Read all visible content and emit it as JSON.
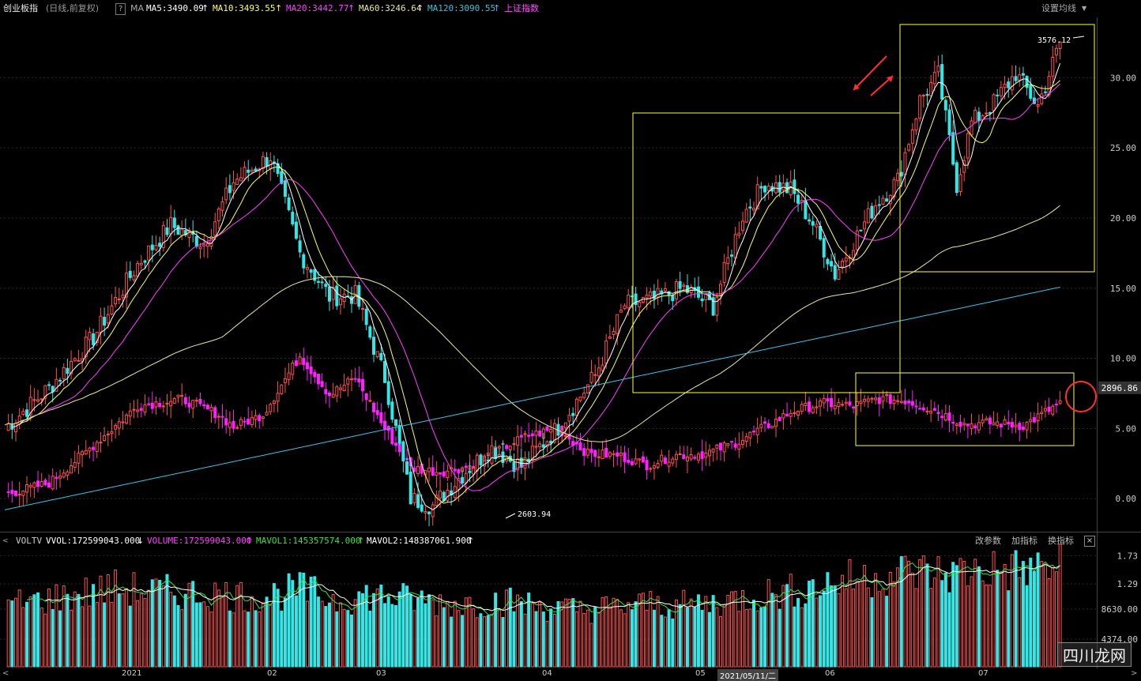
{
  "header": {
    "title": "创业板指",
    "mode": "(日线,前复权)",
    "help": "?",
    "ma_label": "MA",
    "ma5": "MA5:3490.09",
    "ma10": "MA10:3493.55",
    "ma20": "MA20:3442.77",
    "ma60": "MA60:3246.64",
    "ma120": "MA120:3090.55",
    "compare": "上证指数",
    "settings": "设置均线"
  },
  "colors": {
    "up": "#ff5050",
    "down": "#34e6e6",
    "ma5": "#ffffff",
    "ma10": "#ffff60",
    "ma20": "#ff40ff",
    "ma60": "#e8e8a0",
    "ma120": "#40c0e0",
    "box": "#ffff40"
  },
  "chart_data": [
    {
      "type": "candlestick",
      "title": "创业板指",
      "y_ticks_right": [
        "30.00",
        "25.00",
        "20.00",
        "15.00",
        "10.00",
        "5.00",
        "0.00"
      ],
      "ylim": [
        -2.3,
        34.3
      ],
      "highlight_value": "2896.86",
      "annotations": {
        "high": "3576.12",
        "low": "2603.94"
      },
      "x_ticks": [
        "2021",
        "02",
        "03",
        "04",
        "05",
        "2021/05/11/二",
        "06",
        "07"
      ],
      "ma_series": [
        "MA5",
        "MA10",
        "MA20",
        "MA60",
        "MA120"
      ],
      "points": [
        [
          0,
          5.0
        ],
        [
          12,
          7.9
        ],
        [
          24,
          11.5
        ],
        [
          36,
          16.7
        ],
        [
          45,
          19.5
        ],
        [
          54,
          18.2
        ],
        [
          62,
          22.6
        ],
        [
          72,
          24.4
        ],
        [
          80,
          17.5
        ],
        [
          88,
          14.4
        ],
        [
          95,
          14.5
        ],
        [
          103,
          8.6
        ],
        [
          110,
          0.0
        ],
        [
          116,
          -0.5
        ],
        [
          125,
          2.0
        ],
        [
          132,
          3.6
        ],
        [
          140,
          2.3
        ],
        [
          150,
          5.1
        ],
        [
          160,
          8.8
        ],
        [
          168,
          13.8
        ],
        [
          176,
          14.2
        ],
        [
          184,
          15.0
        ],
        [
          192,
          13.7
        ],
        [
          200,
          20.2
        ],
        [
          206,
          22.5
        ],
        [
          213,
          22.0
        ],
        [
          219,
          19.6
        ],
        [
          225,
          16.0
        ],
        [
          230,
          18.3
        ],
        [
          236,
          21.0
        ],
        [
          242,
          22.7
        ],
        [
          248,
          28.4
        ],
        [
          253,
          30.2
        ],
        [
          258,
          22.4
        ],
        [
          262,
          26.8
        ],
        [
          268,
          28.2
        ],
        [
          274,
          30.3
        ],
        [
          280,
          28.0
        ],
        [
          286,
          32.5
        ]
      ]
    },
    {
      "type": "candlestick",
      "title": "上证指数",
      "points": [
        [
          0,
          0.3
        ],
        [
          12,
          1.1
        ],
        [
          24,
          3.8
        ],
        [
          36,
          6.6
        ],
        [
          48,
          7.1
        ],
        [
          58,
          6.0
        ],
        [
          62,
          5.1
        ],
        [
          70,
          6.0
        ],
        [
          80,
          10.2
        ],
        [
          88,
          7.4
        ],
        [
          95,
          8.6
        ],
        [
          103,
          5.0
        ],
        [
          110,
          2.2
        ],
        [
          118,
          1.9
        ],
        [
          126,
          2.3
        ],
        [
          134,
          3.5
        ],
        [
          142,
          4.5
        ],
        [
          150,
          5.0
        ],
        [
          158,
          3.2
        ],
        [
          166,
          3.1
        ],
        [
          174,
          2.4
        ],
        [
          182,
          3.1
        ],
        [
          190,
          3.2
        ],
        [
          198,
          4.0
        ],
        [
          206,
          5.1
        ],
        [
          214,
          6.3
        ],
        [
          222,
          6.8
        ],
        [
          230,
          6.6
        ],
        [
          236,
          7.1
        ],
        [
          244,
          7.0
        ],
        [
          252,
          6.3
        ],
        [
          260,
          5.3
        ],
        [
          268,
          5.4
        ],
        [
          276,
          5.2
        ],
        [
          286,
          6.8
        ]
      ]
    },
    {
      "type": "bar",
      "title": "VOLTV",
      "y_ticks_right": [
        "1.73",
        "1.29",
        "8630.00",
        "4374.00"
      ],
      "ylim": [
        0,
        1.87
      ],
      "series_labels": [
        "VVOL:172599043.000",
        "VOLUME:172599043.000",
        "MAVOL1:145357574.000",
        "MAVOL2:148387061.900"
      ],
      "points": [
        [
          0,
          0.95
        ],
        [
          15,
          1.08
        ],
        [
          30,
          1.22
        ],
        [
          45,
          1.15
        ],
        [
          60,
          1.12
        ],
        [
          70,
          1.08
        ],
        [
          80,
          1.2
        ],
        [
          90,
          1.04
        ],
        [
          100,
          1.12
        ],
        [
          110,
          1.04
        ],
        [
          122,
          0.98
        ],
        [
          135,
          1.02
        ],
        [
          145,
          0.94
        ],
        [
          155,
          0.88
        ],
        [
          165,
          0.92
        ],
        [
          175,
          0.98
        ],
        [
          185,
          0.95
        ],
        [
          195,
          1.02
        ],
        [
          205,
          1.12
        ],
        [
          215,
          1.18
        ],
        [
          225,
          1.32
        ],
        [
          235,
          1.4
        ],
        [
          245,
          1.48
        ],
        [
          255,
          1.44
        ],
        [
          265,
          1.52
        ],
        [
          275,
          1.5
        ],
        [
          286,
          1.55
        ]
      ]
    }
  ],
  "volume_panel": {
    "title": "VOLTV",
    "btn1": "改参数",
    "btn2": "加指标",
    "btn3": "换指标",
    "close": "×"
  },
  "watermark": "四川龙网"
}
